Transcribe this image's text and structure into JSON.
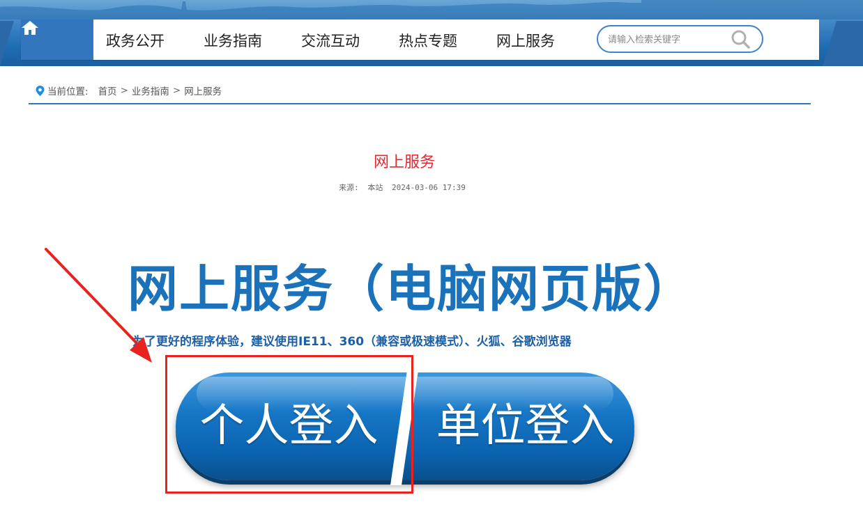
{
  "colors": {
    "accent": "#1a72bb",
    "title_red": "#e8262c",
    "annotation_red": "#e8221f",
    "header_blue": "#3277bd"
  },
  "header": {
    "home_icon": "home-icon",
    "nav_items": [
      "政务公开",
      "业务指南",
      "交流互动",
      "热点专题",
      "网上服务"
    ],
    "search": {
      "placeholder": "请输入检索关键字",
      "icon": "search-icon"
    }
  },
  "breadcrumb": {
    "icon": "location-pin-icon",
    "label": "当前位置:",
    "items": [
      "首页",
      "业务指南",
      "网上服务"
    ],
    "separator": ">"
  },
  "article": {
    "title": "网上服务",
    "source_label": "来源:",
    "source": "本站",
    "datetime": "2024-03-06 17:39"
  },
  "banner": {
    "heading": "网上服务（电脑网页版）",
    "subheading": "为了更好的程序体验，建议使用IE11、360（兼容或极速模式）、火狐、谷歌浏览器",
    "personal_login": "个人登入",
    "unit_login": "单位登入"
  }
}
